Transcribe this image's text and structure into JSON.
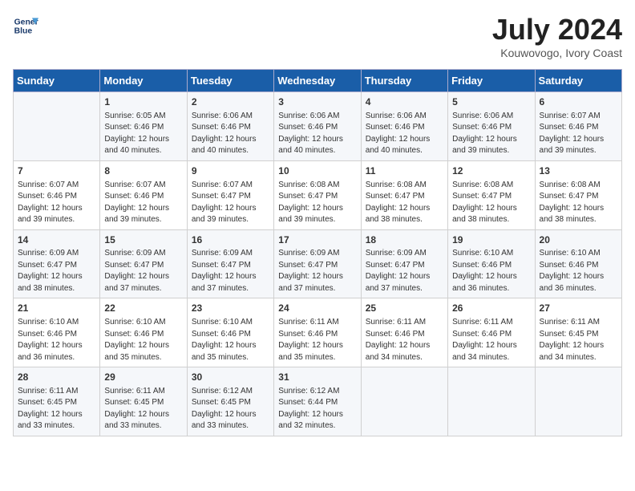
{
  "header": {
    "logo_line1": "General",
    "logo_line2": "Blue",
    "month": "July 2024",
    "location": "Kouwovogo, Ivory Coast"
  },
  "weekdays": [
    "Sunday",
    "Monday",
    "Tuesday",
    "Wednesday",
    "Thursday",
    "Friday",
    "Saturday"
  ],
  "weeks": [
    [
      {
        "day": "",
        "info": ""
      },
      {
        "day": "1",
        "info": "Sunrise: 6:05 AM\nSunset: 6:46 PM\nDaylight: 12 hours\nand 40 minutes."
      },
      {
        "day": "2",
        "info": "Sunrise: 6:06 AM\nSunset: 6:46 PM\nDaylight: 12 hours\nand 40 minutes."
      },
      {
        "day": "3",
        "info": "Sunrise: 6:06 AM\nSunset: 6:46 PM\nDaylight: 12 hours\nand 40 minutes."
      },
      {
        "day": "4",
        "info": "Sunrise: 6:06 AM\nSunset: 6:46 PM\nDaylight: 12 hours\nand 40 minutes."
      },
      {
        "day": "5",
        "info": "Sunrise: 6:06 AM\nSunset: 6:46 PM\nDaylight: 12 hours\nand 39 minutes."
      },
      {
        "day": "6",
        "info": "Sunrise: 6:07 AM\nSunset: 6:46 PM\nDaylight: 12 hours\nand 39 minutes."
      }
    ],
    [
      {
        "day": "7",
        "info": "Sunrise: 6:07 AM\nSunset: 6:46 PM\nDaylight: 12 hours\nand 39 minutes."
      },
      {
        "day": "8",
        "info": "Sunrise: 6:07 AM\nSunset: 6:46 PM\nDaylight: 12 hours\nand 39 minutes."
      },
      {
        "day": "9",
        "info": "Sunrise: 6:07 AM\nSunset: 6:47 PM\nDaylight: 12 hours\nand 39 minutes."
      },
      {
        "day": "10",
        "info": "Sunrise: 6:08 AM\nSunset: 6:47 PM\nDaylight: 12 hours\nand 39 minutes."
      },
      {
        "day": "11",
        "info": "Sunrise: 6:08 AM\nSunset: 6:47 PM\nDaylight: 12 hours\nand 38 minutes."
      },
      {
        "day": "12",
        "info": "Sunrise: 6:08 AM\nSunset: 6:47 PM\nDaylight: 12 hours\nand 38 minutes."
      },
      {
        "day": "13",
        "info": "Sunrise: 6:08 AM\nSunset: 6:47 PM\nDaylight: 12 hours\nand 38 minutes."
      }
    ],
    [
      {
        "day": "14",
        "info": "Sunrise: 6:09 AM\nSunset: 6:47 PM\nDaylight: 12 hours\nand 38 minutes."
      },
      {
        "day": "15",
        "info": "Sunrise: 6:09 AM\nSunset: 6:47 PM\nDaylight: 12 hours\nand 37 minutes."
      },
      {
        "day": "16",
        "info": "Sunrise: 6:09 AM\nSunset: 6:47 PM\nDaylight: 12 hours\nand 37 minutes."
      },
      {
        "day": "17",
        "info": "Sunrise: 6:09 AM\nSunset: 6:47 PM\nDaylight: 12 hours\nand 37 minutes."
      },
      {
        "day": "18",
        "info": "Sunrise: 6:09 AM\nSunset: 6:47 PM\nDaylight: 12 hours\nand 37 minutes."
      },
      {
        "day": "19",
        "info": "Sunrise: 6:10 AM\nSunset: 6:46 PM\nDaylight: 12 hours\nand 36 minutes."
      },
      {
        "day": "20",
        "info": "Sunrise: 6:10 AM\nSunset: 6:46 PM\nDaylight: 12 hours\nand 36 minutes."
      }
    ],
    [
      {
        "day": "21",
        "info": "Sunrise: 6:10 AM\nSunset: 6:46 PM\nDaylight: 12 hours\nand 36 minutes."
      },
      {
        "day": "22",
        "info": "Sunrise: 6:10 AM\nSunset: 6:46 PM\nDaylight: 12 hours\nand 35 minutes."
      },
      {
        "day": "23",
        "info": "Sunrise: 6:10 AM\nSunset: 6:46 PM\nDaylight: 12 hours\nand 35 minutes."
      },
      {
        "day": "24",
        "info": "Sunrise: 6:11 AM\nSunset: 6:46 PM\nDaylight: 12 hours\nand 35 minutes."
      },
      {
        "day": "25",
        "info": "Sunrise: 6:11 AM\nSunset: 6:46 PM\nDaylight: 12 hours\nand 34 minutes."
      },
      {
        "day": "26",
        "info": "Sunrise: 6:11 AM\nSunset: 6:46 PM\nDaylight: 12 hours\nand 34 minutes."
      },
      {
        "day": "27",
        "info": "Sunrise: 6:11 AM\nSunset: 6:45 PM\nDaylight: 12 hours\nand 34 minutes."
      }
    ],
    [
      {
        "day": "28",
        "info": "Sunrise: 6:11 AM\nSunset: 6:45 PM\nDaylight: 12 hours\nand 33 minutes."
      },
      {
        "day": "29",
        "info": "Sunrise: 6:11 AM\nSunset: 6:45 PM\nDaylight: 12 hours\nand 33 minutes."
      },
      {
        "day": "30",
        "info": "Sunrise: 6:12 AM\nSunset: 6:45 PM\nDaylight: 12 hours\nand 33 minutes."
      },
      {
        "day": "31",
        "info": "Sunrise: 6:12 AM\nSunset: 6:44 PM\nDaylight: 12 hours\nand 32 minutes."
      },
      {
        "day": "",
        "info": ""
      },
      {
        "day": "",
        "info": ""
      },
      {
        "day": "",
        "info": ""
      }
    ]
  ]
}
